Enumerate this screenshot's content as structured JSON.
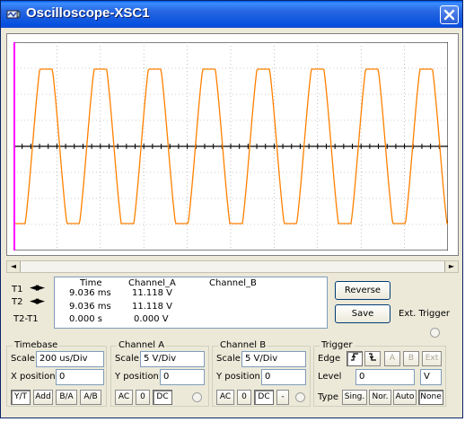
{
  "window": {
    "title": "Oscilloscope-XSC1"
  },
  "colors": {
    "trace": "#ff8000",
    "cursor": "#ff00ff",
    "titlebar": "#0054e3",
    "face": "#ece9d8"
  },
  "signal": {
    "shape": "clipped-sine",
    "cycles_visible": 8
  },
  "readout": {
    "headers": {
      "time": "Time",
      "cha": "Channel_A",
      "chb": "Channel_B"
    },
    "rows": [
      {
        "label": "T1",
        "time": "9.036 ms",
        "cha": "11.118 V",
        "chb": ""
      },
      {
        "label": "T2",
        "time": "9.036 ms",
        "cha": "11.118 V",
        "chb": ""
      },
      {
        "label": "T2-T1",
        "time": "0.000 s",
        "cha": "0.000 V",
        "chb": ""
      }
    ]
  },
  "buttons": {
    "reverse": "Reverse",
    "save": "Save",
    "ext_trigger": "Ext. Trigger"
  },
  "timebase": {
    "title": "Timebase",
    "scale_label": "Scale",
    "scale": "200 us/Div",
    "xpos_label": "X position",
    "xpos": "0",
    "modes": [
      "Y/T",
      "Add",
      "B/A",
      "A/B"
    ]
  },
  "channel_a": {
    "title": "Channel A",
    "scale_label": "Scale",
    "scale": "5  V/Div",
    "ypos_label": "Y position",
    "ypos": "0",
    "coupling": [
      "AC",
      "0",
      "DC"
    ]
  },
  "channel_b": {
    "title": "Channel B",
    "scale_label": "Scale",
    "scale": "5  V/Div",
    "ypos_label": "Y position",
    "ypos": "0",
    "coupling": [
      "AC",
      "0",
      "DC",
      "-"
    ]
  },
  "trigger": {
    "title": "Trigger",
    "edge_label": "Edge",
    "edge_sources": [
      "A",
      "B",
      "Ext"
    ],
    "level_label": "Level",
    "level": "0",
    "level_unit": "V",
    "type_label": "Type",
    "types": [
      "Sing.",
      "Nor.",
      "Auto",
      "None"
    ]
  }
}
